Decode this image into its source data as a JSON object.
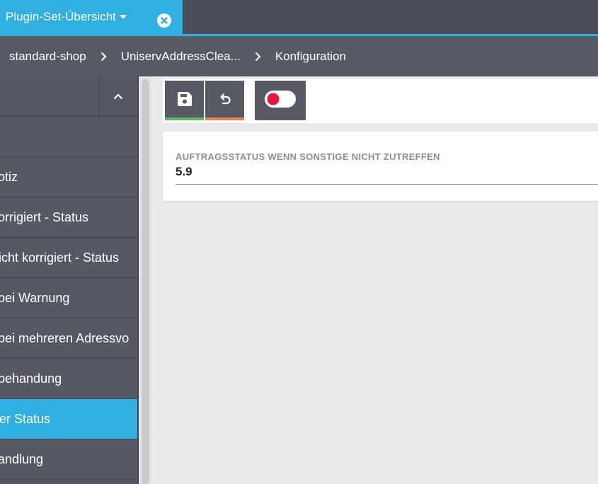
{
  "tab": {
    "title": "Plugin-Set-Übersicht",
    "caret_icon": "caret-down-icon",
    "close_icon": "close-circle-icon"
  },
  "breadcrumb": {
    "items": [
      "standard-shop",
      "UniservAddressClea...",
      "Konfiguration"
    ],
    "separator_icon": "chevron-right-icon"
  },
  "sidebar": {
    "collapse_icon": "chevron-up-icon",
    "items": [
      {
        "label": ""
      },
      {
        "label": "otiz"
      },
      {
        "label": "orrigiert - Status"
      },
      {
        "label": "icht korrigiert - Status"
      },
      {
        "label": "bei Warnung"
      },
      {
        "label": "bei mehreren Adressvo"
      },
      {
        "label": "behandung"
      },
      {
        "label": "er Status",
        "active": true
      },
      {
        "label": "andlung"
      }
    ]
  },
  "toolbar": {
    "save_icon": "save-icon",
    "undo_icon": "undo-icon",
    "toggle_icon": "toggle-off-icon",
    "save_accent": "#5cb85c",
    "undo_accent": "#e8834a",
    "toggle_dot_color": "#e5173f"
  },
  "form": {
    "field_label": "AUFTRAGSSTATUS WENN SONSTIGE NICHT ZUTREFFEN",
    "field_value": "5.9"
  },
  "colors": {
    "accent": "#2fb0e0",
    "topbar": "#4b4e58",
    "sidebar": "#565964"
  }
}
